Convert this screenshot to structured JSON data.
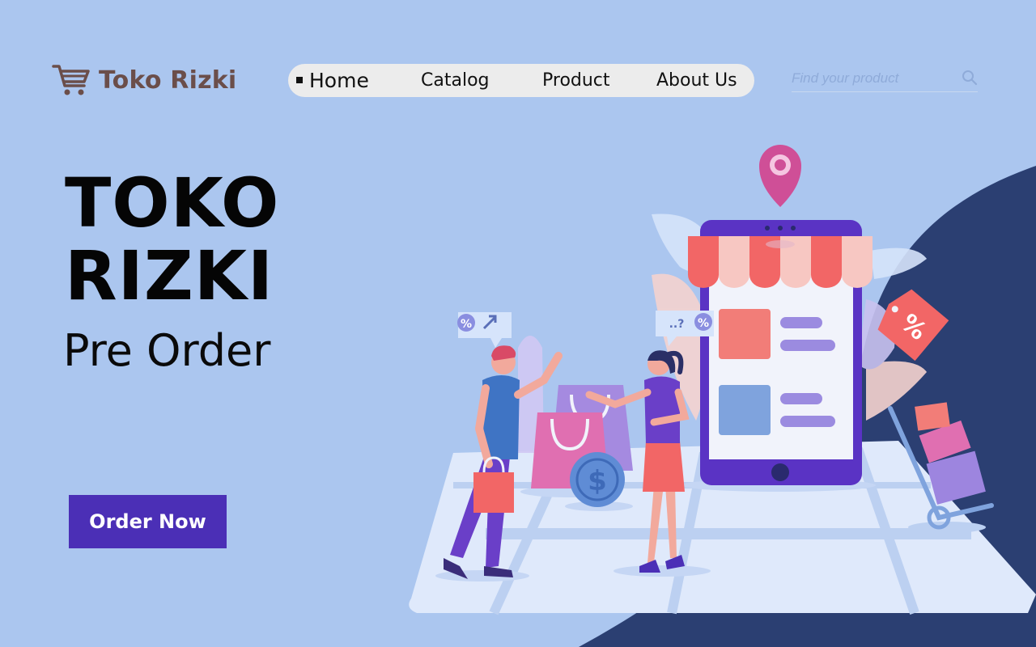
{
  "brand": {
    "name": "Toko Rizki",
    "logo_icon": "shopping-cart-icon",
    "color": "#6b4e4a"
  },
  "nav": {
    "items": [
      {
        "label": "Home",
        "active": true
      },
      {
        "label": "Catalog",
        "active": false
      },
      {
        "label": "Product",
        "active": false
      },
      {
        "label": "About Us",
        "active": false
      }
    ]
  },
  "search": {
    "placeholder": "Find your product",
    "icon": "search-icon"
  },
  "hero": {
    "title_line1": "TOKO",
    "title_line2": "RIZKI",
    "subtitle": "Pre Order",
    "cta_label": "Order Now",
    "cta_color": "#4b2fb6"
  },
  "illustration": {
    "left_bubble_icons": [
      "percent-icon",
      "arrow-up-right-icon"
    ],
    "right_bubble_text": "..?",
    "right_bubble_icon": "percent-icon",
    "tag_text": "%",
    "coin_symbol": "$"
  },
  "colors": {
    "background": "#abc6ef",
    "dark_wave": "#2b3f72",
    "accent": "#4b2fb6"
  }
}
